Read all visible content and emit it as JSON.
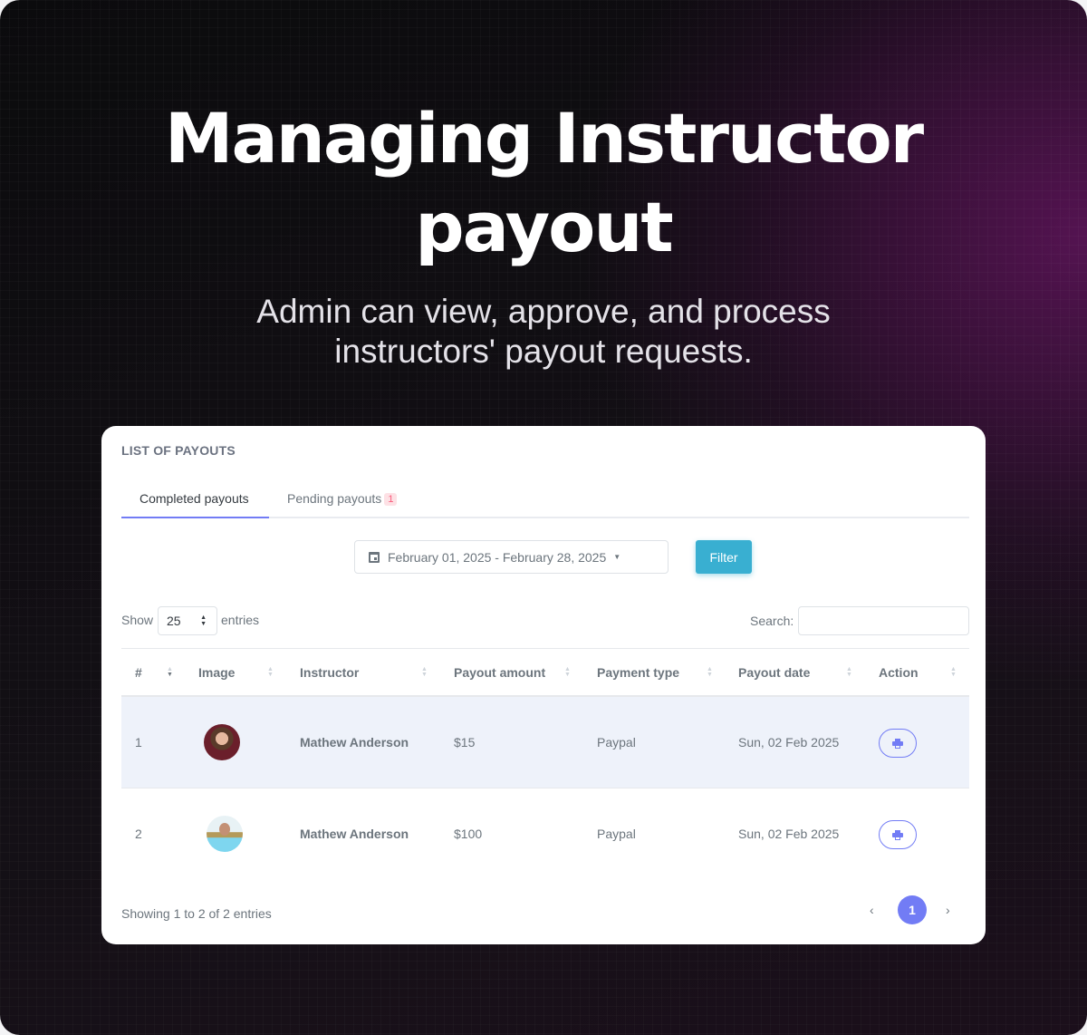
{
  "hero": {
    "title_line1": "Managing Instructor",
    "title_line2": "payout",
    "subtitle_line1": "Admin can view, approve, and process",
    "subtitle_line2": "instructors' payout requests."
  },
  "card": {
    "title": "LIST OF PAYOUTS",
    "tabs": [
      {
        "label": "Completed payouts",
        "active": true
      },
      {
        "label": "Pending payouts",
        "badge": "1",
        "active": false
      }
    ],
    "date_range": "February 01, 2025 - February 28, 2025",
    "filter_label": "Filter",
    "show_label": "Show",
    "entries_value": "25",
    "entries_label": "entries",
    "search_label": "Search:",
    "search_value": "",
    "columns": [
      "#",
      "Image",
      "Instructor",
      "Payout amount",
      "Payment type",
      "Payout date",
      "Action"
    ],
    "rows": [
      {
        "index": "1",
        "instructor": "Mathew Anderson",
        "amount": "$15",
        "type": "Paypal",
        "date": "Sun, 02 Feb 2025",
        "action_icon": "print-icon"
      },
      {
        "index": "2",
        "instructor": "Mathew Anderson",
        "amount": "$100",
        "type": "Paypal",
        "date": "Sun, 02 Feb 2025",
        "action_icon": "print-icon"
      }
    ],
    "info": "Showing 1 to 2 of 2 entries",
    "pagination": {
      "prev": "‹",
      "current": "1",
      "next": "›"
    }
  },
  "colors": {
    "accent": "#727cf5",
    "filter_button": "#39afd1",
    "badge_text": "#fa5c7c",
    "badge_bg": "#fde1e5",
    "highlight_row": "#eef2fa"
  }
}
